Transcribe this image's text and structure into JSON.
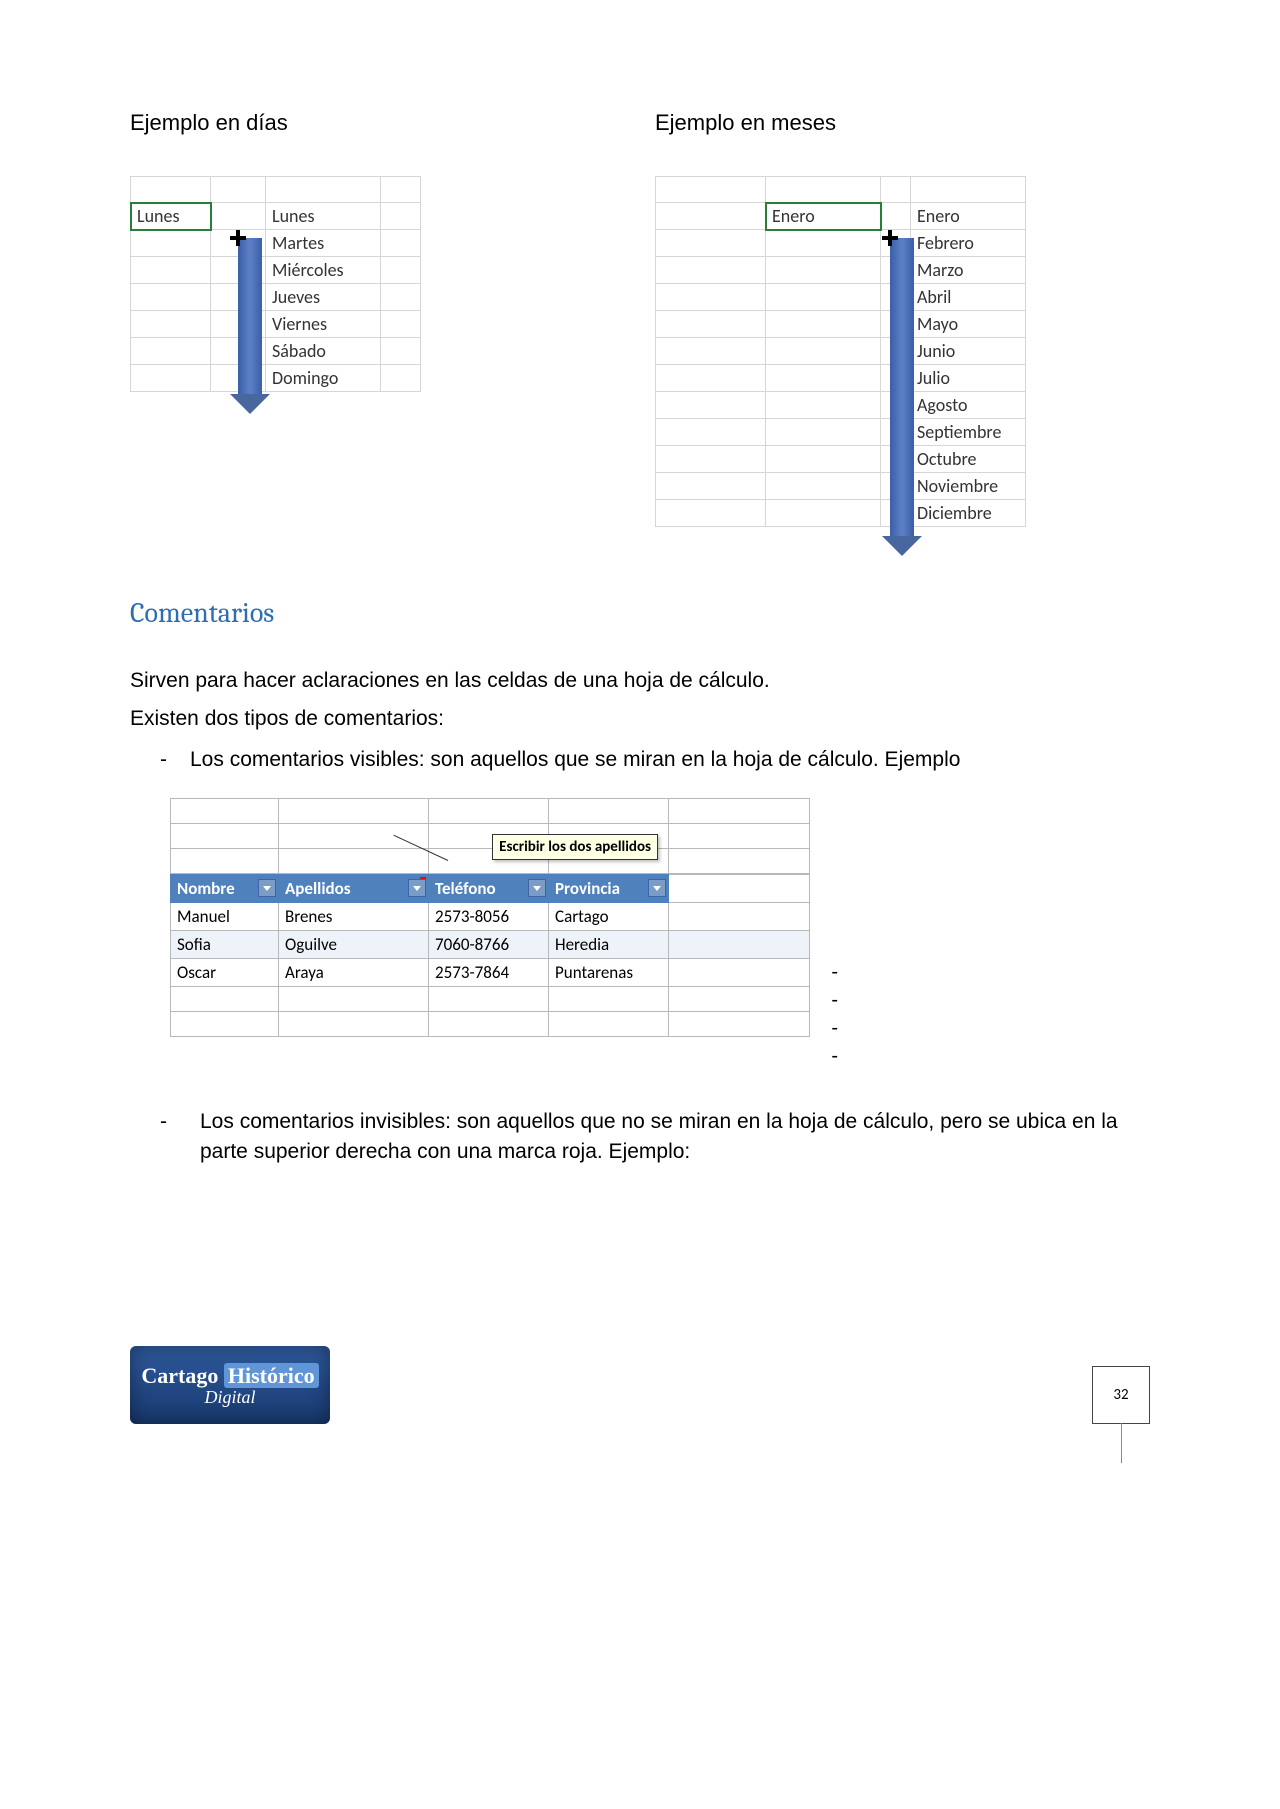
{
  "heading_dias": "Ejemplo en días",
  "heading_meses": "Ejemplo en meses",
  "dias": {
    "selected": "Lunes",
    "list": [
      "Lunes",
      "Martes",
      "Miércoles",
      "Jueves",
      "Viernes",
      "Sábado",
      "Domingo"
    ]
  },
  "meses": {
    "selected": "Enero",
    "list": [
      "Enero",
      "Febrero",
      "Marzo",
      "Abril",
      "Mayo",
      "Junio",
      "Julio",
      "Agosto",
      "Septiembre",
      "Octubre",
      "Noviembre",
      "Diciembre"
    ]
  },
  "section_title": "Comentarios",
  "para1": "Sirven para hacer aclaraciones en las celdas de una hoja de cálculo.",
  "para2": "Existen dos tipos de comentarios:",
  "bullet1": "Los comentarios visibles: son aquellos que se miran en la hoja de cálculo. Ejemplo",
  "bullet2": "Los comentarios invisibles: son aquellos que no se miran en la hoja de cálculo, pero se ubica en la parte superior derecha con una marca roja. Ejemplo:",
  "comment_text": "Escribir los dos apellidos",
  "table": {
    "headers": [
      "Nombre",
      "Apellidos",
      "Teléfono",
      "Provincia"
    ],
    "rows": [
      [
        "Manuel",
        "Brenes",
        "2573-8056",
        "Cartago"
      ],
      [
        "Sofia",
        "Oguilve",
        "7060-8766",
        "Heredia"
      ],
      [
        "Oscar",
        "Araya",
        "2573-7864",
        "Puntarenas"
      ]
    ]
  },
  "logo": {
    "line1a": "Cartago",
    "line1b": "Histórico",
    "line2": "Digital"
  },
  "page_number": "32"
}
